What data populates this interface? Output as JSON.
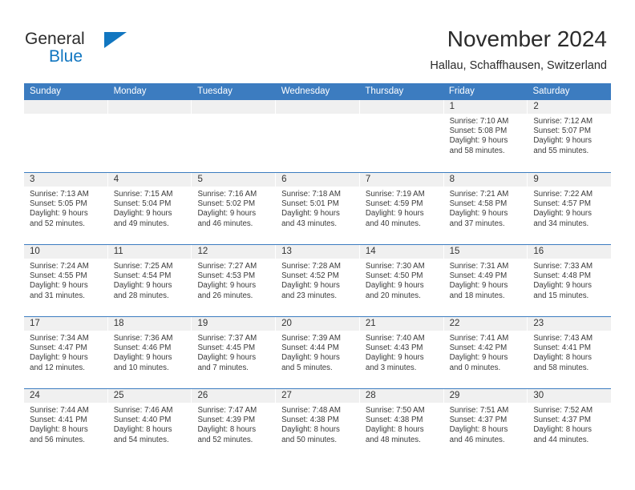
{
  "brand": {
    "line1": "General",
    "line2": "Blue",
    "icon": "triangle-logo"
  },
  "header": {
    "title": "November 2024",
    "location": "Hallau, Schaffhausen, Switzerland"
  },
  "weekdays": [
    "Sunday",
    "Monday",
    "Tuesday",
    "Wednesday",
    "Thursday",
    "Friday",
    "Saturday"
  ],
  "colors": {
    "header_blue": "#3c7cc0",
    "brand_blue": "#1176c0",
    "cell_head_gray": "#f0f0f0",
    "text_dark": "#2b2b2b"
  },
  "weeks": [
    [
      {
        "empty": true
      },
      {
        "empty": true
      },
      {
        "empty": true
      },
      {
        "empty": true
      },
      {
        "empty": true
      },
      {
        "day": "1",
        "sunrise": "Sunrise: 7:10 AM",
        "sunset": "Sunset: 5:08 PM",
        "daylight1": "Daylight: 9 hours",
        "daylight2": "and 58 minutes."
      },
      {
        "day": "2",
        "sunrise": "Sunrise: 7:12 AM",
        "sunset": "Sunset: 5:07 PM",
        "daylight1": "Daylight: 9 hours",
        "daylight2": "and 55 minutes."
      }
    ],
    [
      {
        "day": "3",
        "sunrise": "Sunrise: 7:13 AM",
        "sunset": "Sunset: 5:05 PM",
        "daylight1": "Daylight: 9 hours",
        "daylight2": "and 52 minutes."
      },
      {
        "day": "4",
        "sunrise": "Sunrise: 7:15 AM",
        "sunset": "Sunset: 5:04 PM",
        "daylight1": "Daylight: 9 hours",
        "daylight2": "and 49 minutes."
      },
      {
        "day": "5",
        "sunrise": "Sunrise: 7:16 AM",
        "sunset": "Sunset: 5:02 PM",
        "daylight1": "Daylight: 9 hours",
        "daylight2": "and 46 minutes."
      },
      {
        "day": "6",
        "sunrise": "Sunrise: 7:18 AM",
        "sunset": "Sunset: 5:01 PM",
        "daylight1": "Daylight: 9 hours",
        "daylight2": "and 43 minutes."
      },
      {
        "day": "7",
        "sunrise": "Sunrise: 7:19 AM",
        "sunset": "Sunset: 4:59 PM",
        "daylight1": "Daylight: 9 hours",
        "daylight2": "and 40 minutes."
      },
      {
        "day": "8",
        "sunrise": "Sunrise: 7:21 AM",
        "sunset": "Sunset: 4:58 PM",
        "daylight1": "Daylight: 9 hours",
        "daylight2": "and 37 minutes."
      },
      {
        "day": "9",
        "sunrise": "Sunrise: 7:22 AM",
        "sunset": "Sunset: 4:57 PM",
        "daylight1": "Daylight: 9 hours",
        "daylight2": "and 34 minutes."
      }
    ],
    [
      {
        "day": "10",
        "sunrise": "Sunrise: 7:24 AM",
        "sunset": "Sunset: 4:55 PM",
        "daylight1": "Daylight: 9 hours",
        "daylight2": "and 31 minutes."
      },
      {
        "day": "11",
        "sunrise": "Sunrise: 7:25 AM",
        "sunset": "Sunset: 4:54 PM",
        "daylight1": "Daylight: 9 hours",
        "daylight2": "and 28 minutes."
      },
      {
        "day": "12",
        "sunrise": "Sunrise: 7:27 AM",
        "sunset": "Sunset: 4:53 PM",
        "daylight1": "Daylight: 9 hours",
        "daylight2": "and 26 minutes."
      },
      {
        "day": "13",
        "sunrise": "Sunrise: 7:28 AM",
        "sunset": "Sunset: 4:52 PM",
        "daylight1": "Daylight: 9 hours",
        "daylight2": "and 23 minutes."
      },
      {
        "day": "14",
        "sunrise": "Sunrise: 7:30 AM",
        "sunset": "Sunset: 4:50 PM",
        "daylight1": "Daylight: 9 hours",
        "daylight2": "and 20 minutes."
      },
      {
        "day": "15",
        "sunrise": "Sunrise: 7:31 AM",
        "sunset": "Sunset: 4:49 PM",
        "daylight1": "Daylight: 9 hours",
        "daylight2": "and 18 minutes."
      },
      {
        "day": "16",
        "sunrise": "Sunrise: 7:33 AM",
        "sunset": "Sunset: 4:48 PM",
        "daylight1": "Daylight: 9 hours",
        "daylight2": "and 15 minutes."
      }
    ],
    [
      {
        "day": "17",
        "sunrise": "Sunrise: 7:34 AM",
        "sunset": "Sunset: 4:47 PM",
        "daylight1": "Daylight: 9 hours",
        "daylight2": "and 12 minutes."
      },
      {
        "day": "18",
        "sunrise": "Sunrise: 7:36 AM",
        "sunset": "Sunset: 4:46 PM",
        "daylight1": "Daylight: 9 hours",
        "daylight2": "and 10 minutes."
      },
      {
        "day": "19",
        "sunrise": "Sunrise: 7:37 AM",
        "sunset": "Sunset: 4:45 PM",
        "daylight1": "Daylight: 9 hours",
        "daylight2": "and 7 minutes."
      },
      {
        "day": "20",
        "sunrise": "Sunrise: 7:39 AM",
        "sunset": "Sunset: 4:44 PM",
        "daylight1": "Daylight: 9 hours",
        "daylight2": "and 5 minutes."
      },
      {
        "day": "21",
        "sunrise": "Sunrise: 7:40 AM",
        "sunset": "Sunset: 4:43 PM",
        "daylight1": "Daylight: 9 hours",
        "daylight2": "and 3 minutes."
      },
      {
        "day": "22",
        "sunrise": "Sunrise: 7:41 AM",
        "sunset": "Sunset: 4:42 PM",
        "daylight1": "Daylight: 9 hours",
        "daylight2": "and 0 minutes."
      },
      {
        "day": "23",
        "sunrise": "Sunrise: 7:43 AM",
        "sunset": "Sunset: 4:41 PM",
        "daylight1": "Daylight: 8 hours",
        "daylight2": "and 58 minutes."
      }
    ],
    [
      {
        "day": "24",
        "sunrise": "Sunrise: 7:44 AM",
        "sunset": "Sunset: 4:41 PM",
        "daylight1": "Daylight: 8 hours",
        "daylight2": "and 56 minutes."
      },
      {
        "day": "25",
        "sunrise": "Sunrise: 7:46 AM",
        "sunset": "Sunset: 4:40 PM",
        "daylight1": "Daylight: 8 hours",
        "daylight2": "and 54 minutes."
      },
      {
        "day": "26",
        "sunrise": "Sunrise: 7:47 AM",
        "sunset": "Sunset: 4:39 PM",
        "daylight1": "Daylight: 8 hours",
        "daylight2": "and 52 minutes."
      },
      {
        "day": "27",
        "sunrise": "Sunrise: 7:48 AM",
        "sunset": "Sunset: 4:38 PM",
        "daylight1": "Daylight: 8 hours",
        "daylight2": "and 50 minutes."
      },
      {
        "day": "28",
        "sunrise": "Sunrise: 7:50 AM",
        "sunset": "Sunset: 4:38 PM",
        "daylight1": "Daylight: 8 hours",
        "daylight2": "and 48 minutes."
      },
      {
        "day": "29",
        "sunrise": "Sunrise: 7:51 AM",
        "sunset": "Sunset: 4:37 PM",
        "daylight1": "Daylight: 8 hours",
        "daylight2": "and 46 minutes."
      },
      {
        "day": "30",
        "sunrise": "Sunrise: 7:52 AM",
        "sunset": "Sunset: 4:37 PM",
        "daylight1": "Daylight: 8 hours",
        "daylight2": "and 44 minutes."
      }
    ]
  ]
}
